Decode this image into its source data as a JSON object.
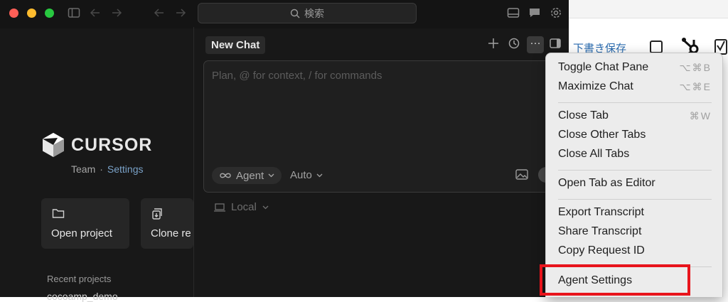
{
  "titlebar": {
    "search_placeholder": "検索"
  },
  "welcome": {
    "logo_text": "CURSOR",
    "team_label": "Team",
    "separator": "·",
    "settings_link": "Settings",
    "cards": [
      {
        "label": "Open project",
        "icon": "folder-icon"
      },
      {
        "label": "Clone re",
        "icon": "clone-icon"
      }
    ],
    "recent_projects_title": "Recent projects",
    "recent_item": "cocoamp_demo"
  },
  "chat": {
    "tab_title": "New Chat",
    "more_label": "···",
    "composer_placeholder": "Plan, @ for context, / for commands",
    "agent_label": "Agent",
    "auto_label": "Auto",
    "local_label": "Local"
  },
  "background_app": {
    "draft_link": "下書き保存"
  },
  "menu": {
    "items": [
      {
        "label": "Toggle Chat Pane",
        "shortcut": "⌥⌘B"
      },
      {
        "label": "Maximize Chat",
        "shortcut": "⌥⌘E"
      },
      {
        "label": "Close Tab",
        "shortcut": "⌘W"
      },
      {
        "label": "Close Other Tabs",
        "shortcut": ""
      },
      {
        "label": "Close All Tabs",
        "shortcut": ""
      },
      {
        "label": "Open Tab as Editor",
        "shortcut": ""
      },
      {
        "label": "Export Transcript",
        "shortcut": ""
      },
      {
        "label": "Share Transcript",
        "shortcut": ""
      },
      {
        "label": "Copy Request ID",
        "shortcut": ""
      },
      {
        "label": "Agent Settings",
        "shortcut": ""
      }
    ]
  },
  "colors": {
    "highlight": "#e8141c",
    "settings_link": "#7aa2c8"
  }
}
